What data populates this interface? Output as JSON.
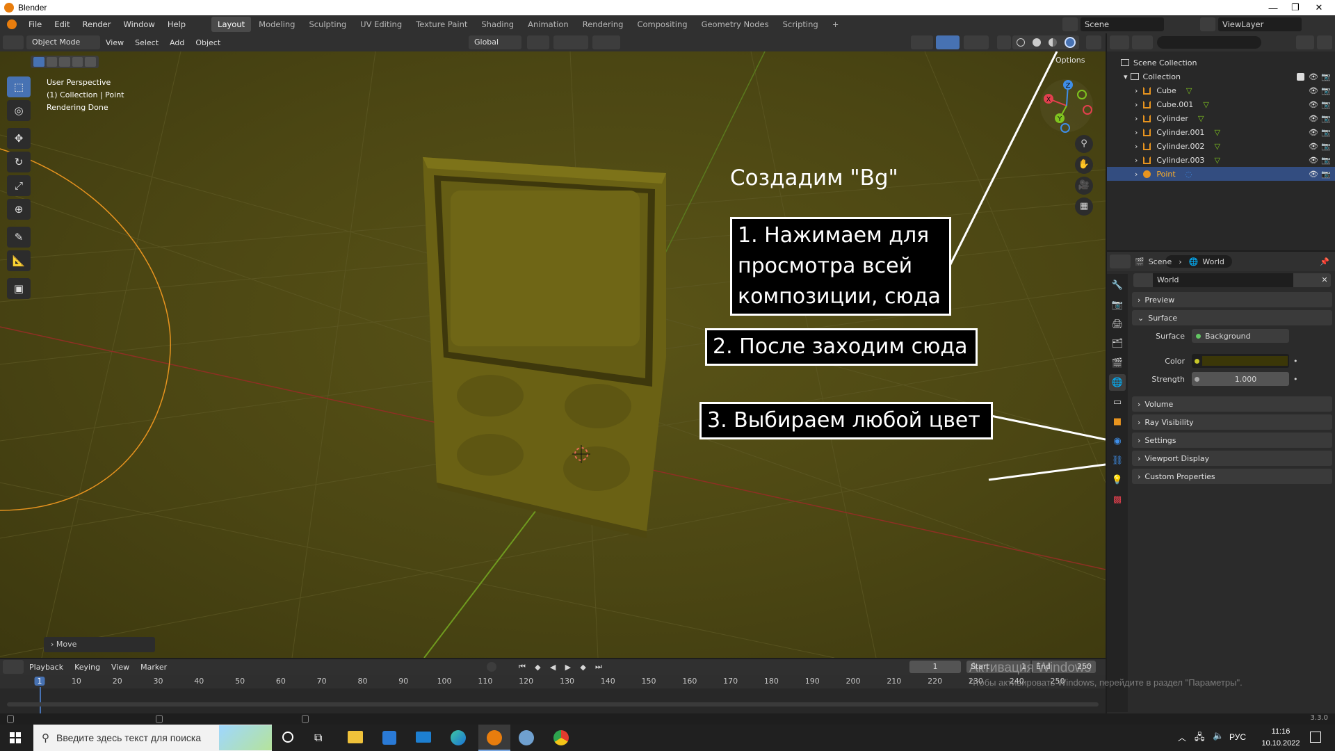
{
  "window": {
    "title": "Blender",
    "minimize": "—",
    "restore": "❐",
    "close": "✕"
  },
  "menu": {
    "items": [
      "File",
      "Edit",
      "Render",
      "Window",
      "Help"
    ],
    "workspaces": [
      "Layout",
      "Modeling",
      "Sculpting",
      "UV Editing",
      "Texture Paint",
      "Shading",
      "Animation",
      "Rendering",
      "Compositing",
      "Geometry Nodes",
      "Scripting"
    ],
    "add_workspace": "+",
    "scene_label": "Scene",
    "viewlayer_label": "ViewLayer"
  },
  "viewport_header": {
    "mode": "Object Mode",
    "menus": [
      "View",
      "Select",
      "Add",
      "Object"
    ],
    "transform_orientation": "Global",
    "options_label": "Options"
  },
  "viewport": {
    "info": [
      "User Perspective",
      "(1) Collection | Point",
      "Rendering Done"
    ],
    "last_op": "Move",
    "gizmo_axes": [
      "X",
      "Y",
      "Z"
    ],
    "object_color": "#6e6416",
    "background_color": "#4b4613"
  },
  "annotations": {
    "title": "Создадим \"Bg\"",
    "step1": [
      "1. Нажимаем для",
      "просмотра всей",
      "композиции, сюда"
    ],
    "step2": "2. После заходим сюда",
    "step3": "3. Выбираем любой цвет"
  },
  "outliner": {
    "scene_collection": "Scene Collection",
    "collection": "Collection",
    "objects": [
      {
        "name": "Cube",
        "selected": false
      },
      {
        "name": "Cube.001",
        "selected": false
      },
      {
        "name": "Cylinder",
        "selected": false
      },
      {
        "name": "Cylinder.001",
        "selected": false
      },
      {
        "name": "Cylinder.002",
        "selected": false
      },
      {
        "name": "Cylinder.003",
        "selected": false
      },
      {
        "name": "Point",
        "selected": true
      }
    ]
  },
  "properties": {
    "breadcrumb": [
      "Scene",
      "World"
    ],
    "world_name": "World",
    "panels": {
      "preview": "Preview",
      "surface": "Surface",
      "volume": "Volume",
      "ray_visibility": "Ray Visibility",
      "settings": "Settings",
      "viewport_display": "Viewport Display",
      "custom_properties": "Custom Properties"
    },
    "surface_label": "Surface",
    "surface_value": "Background",
    "color_label": "Color",
    "color_value": "#3b3708",
    "strength_label": "Strength",
    "strength_value": "1.000"
  },
  "timeline": {
    "menus": [
      "Playback",
      "Keying",
      "View",
      "Marker"
    ],
    "current_frame": "1",
    "start_label": "Start",
    "start_value": "1",
    "end_label": "End",
    "end_value": "250",
    "ticks": [
      "1",
      "10",
      "20",
      "30",
      "40",
      "50",
      "60",
      "70",
      "80",
      "90",
      "100",
      "110",
      "120",
      "130",
      "140",
      "150",
      "160",
      "170",
      "180",
      "190",
      "200",
      "210",
      "220",
      "230",
      "240",
      "250"
    ]
  },
  "watermark": {
    "line1": "Активация Windows",
    "line2": "Чтобы активировать Windows, перейдите в раздел \"Параметры\"."
  },
  "status": {
    "version": "3.3.0"
  },
  "taskbar": {
    "search_placeholder": "Введите здесь текст для поиска",
    "lang": "РУС",
    "time": "11:16",
    "date": "10.10.2022"
  }
}
